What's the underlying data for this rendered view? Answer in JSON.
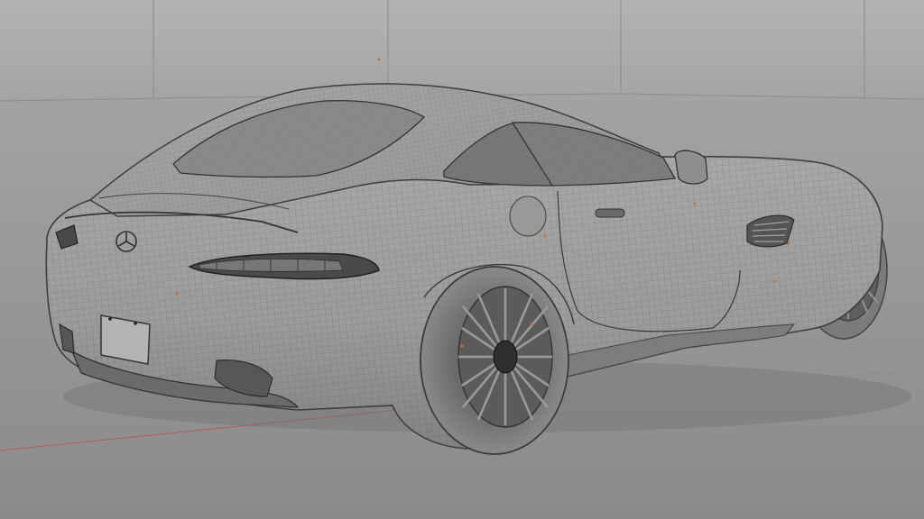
{
  "scene": {
    "subject": "car-wireframe-model",
    "colors": {
      "backdrop_top": "#b1b1b1",
      "backdrop_bottom": "#a4a4a4",
      "floor_top": "#a2a2a2",
      "floor_bottom": "#8b8b8b",
      "body": "#9d9d9d",
      "body_shadow": "#7f7f7f",
      "glass": "#787878",
      "wire": "#4f4f4f",
      "tire": "#848484",
      "rim": "#6e6e6e",
      "axis_red": "#b35a5a",
      "axis_green": "#6e9a6e",
      "vertex_marker": "#c8703c"
    },
    "icons": [
      "brand-logo-icon"
    ]
  }
}
